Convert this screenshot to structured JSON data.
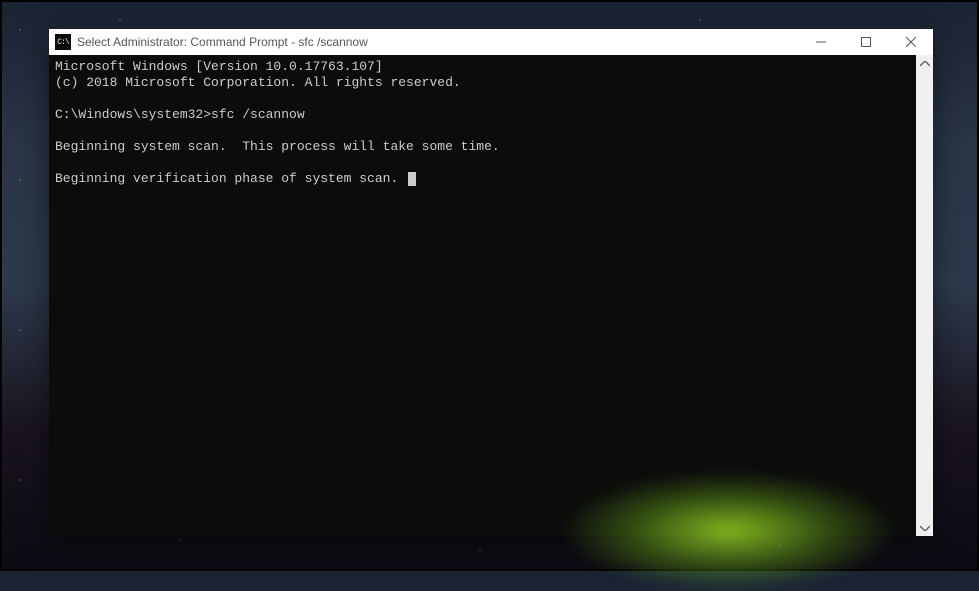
{
  "window": {
    "title": "Select Administrator: Command Prompt - sfc  /scannow",
    "icon_text": "C:\\"
  },
  "terminal": {
    "lines": [
      "Microsoft Windows [Version 10.0.17763.107]",
      "(c) 2018 Microsoft Corporation. All rights reserved.",
      "",
      "C:\\Windows\\system32>sfc /scannow",
      "",
      "Beginning system scan.  This process will take some time.",
      ""
    ],
    "last_line": "Beginning verification phase of system scan."
  }
}
